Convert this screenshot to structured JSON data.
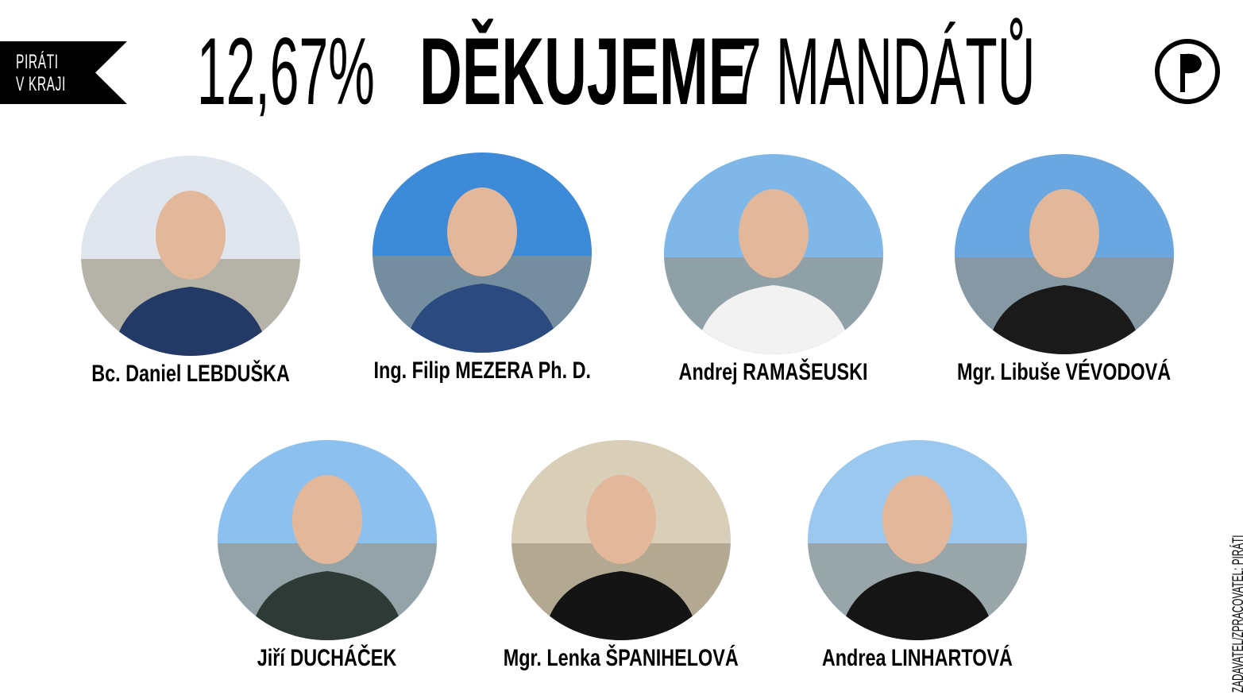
{
  "ribbon": {
    "line1": "PIRÁTI",
    "line2": "V KRAJI"
  },
  "headline": {
    "percent": "12,67%",
    "thanks": "DĚKUJEME",
    "seats": "7 MANDÁTŮ"
  },
  "logo": {
    "icon": "pirate-flag-logo-icon",
    "color": "#000000"
  },
  "candidates": [
    {
      "name": "Bc. Daniel LEBDUŠKA",
      "sky": "#dfe6ee",
      "jacket": "#233a66"
    },
    {
      "name": "Ing. Filip MEZERA Ph. D.",
      "sky": "#3d8ad8",
      "jacket": "#2a4a80"
    },
    {
      "name": "Andrej RAMAŠEUSKI",
      "sky": "#7fb8e8",
      "jacket": "#f2f2f2"
    },
    {
      "name": "Mgr. Libuše VÉVODOVÁ",
      "sky": "#6aa6e0",
      "jacket": "#1a1a1a"
    },
    {
      "name": "Jiří DUCHÁČEK",
      "sky": "#8cc0ee",
      "jacket": "#2e3a36"
    },
    {
      "name": "Mgr. Lenka ŠPANIHELOVÁ",
      "sky": "#d9cfb8",
      "jacket": "#141414"
    },
    {
      "name": "Andrea LINHARTOVÁ",
      "sky": "#9ac8ef",
      "jacket": "#151515"
    }
  ],
  "footer": {
    "credit": "ZADAVATEL/ZPRACOVATEL: PIRÁTI"
  }
}
